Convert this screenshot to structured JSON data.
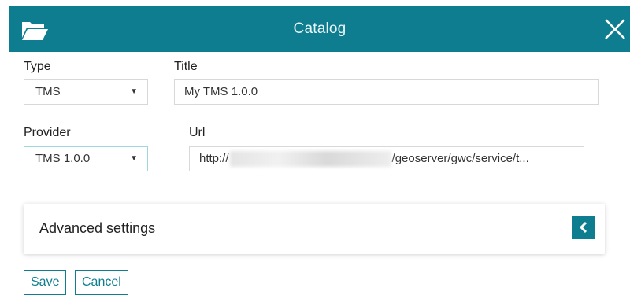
{
  "header": {
    "title": "Catalog",
    "icon": "folder-open-icon",
    "close_icon": "close-icon",
    "color": "#0e7d8f"
  },
  "form": {
    "type": {
      "label": "Type",
      "value": "TMS"
    },
    "title": {
      "label": "Title",
      "value": "My TMS 1.0.0"
    },
    "provider": {
      "label": "Provider",
      "value": "TMS 1.0.0"
    },
    "url": {
      "label": "Url",
      "value_start": "http://",
      "value_end": "/geoserver/gwc/service/t..."
    }
  },
  "advanced": {
    "title": "Advanced settings",
    "toggle_icon": "chevron-left-icon"
  },
  "buttons": {
    "save": "Save",
    "cancel": "Cancel"
  }
}
